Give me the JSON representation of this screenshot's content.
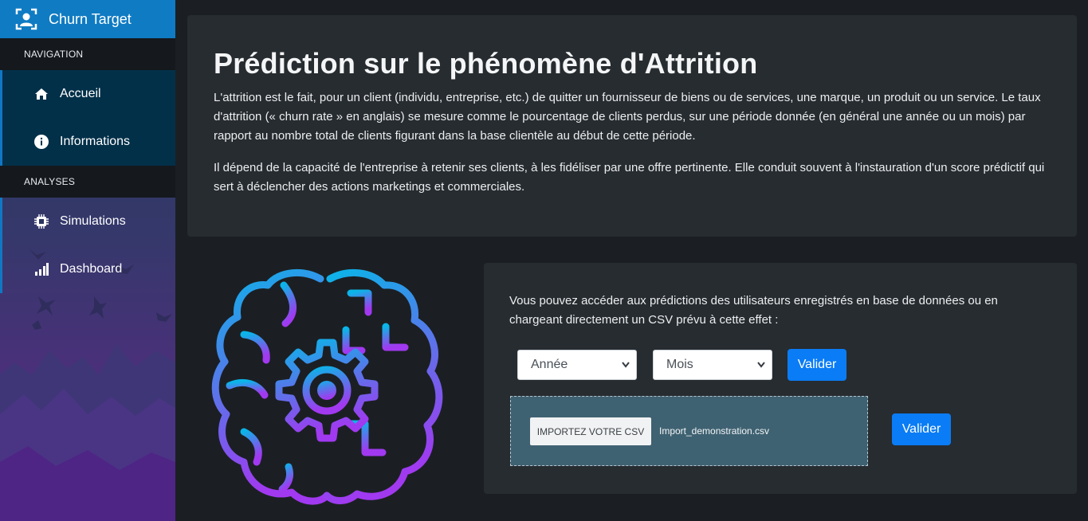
{
  "app": {
    "title": "Churn Target",
    "accent": "#0f7bc3"
  },
  "sidebar": {
    "sections": [
      {
        "header": "NAVIGATION",
        "items": [
          {
            "label": "Accueil",
            "icon": "home-icon"
          },
          {
            "label": "Informations",
            "icon": "info-icon"
          }
        ]
      },
      {
        "header": "ANALYSES",
        "items": [
          {
            "label": "Simulations",
            "icon": "chip-icon"
          },
          {
            "label": "Dashboard",
            "icon": "bar-chart-icon"
          }
        ]
      }
    ]
  },
  "hero": {
    "title": "Prédiction sur le phénomène d'Attrition",
    "paragraph1": "L'attrition est le fait, pour un client (individu, entreprise, etc.) de quitter un fournisseur de biens ou de services, une marque, un produit ou un service. Le taux d'attrition (« churn rate » en anglais) se mesure comme le pourcentage de clients perdus, sur une période donnée (en général une année ou un mois) par rapport au nombre total de clients figurant dans la base clientèle au début de cette période.",
    "paragraph2": "Il dépend de la capacité de l'entreprise à retenir ses clients, à les fidéliser par une offre pertinente. Elle conduit souvent à l'instauration d'un score prédictif qui sert à déclencher des actions marketings et commerciales."
  },
  "illustration": {
    "icon": "brain-gear-icon"
  },
  "prediction_panel": {
    "intro": "Vous pouvez accéder aux prédictions des utilisateurs enregistrés en base de données ou en chargeant directement un CSV prévu à cette effet :",
    "year_select": "Année",
    "month_select": "Mois",
    "validate_label": "Valider",
    "import_label": "IMPORTEZ VOTRE CSV",
    "file_name": "Import_demonstration.csv",
    "validate_csv_label": "Valider",
    "button_color": "#0a7cf5"
  }
}
